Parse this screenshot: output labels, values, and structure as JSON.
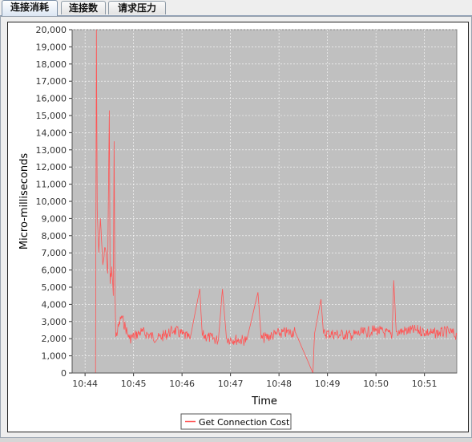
{
  "tabs": [
    {
      "label": "连接消耗",
      "active": true
    },
    {
      "label": "连接数",
      "active": false
    },
    {
      "label": "请求压力",
      "active": false
    }
  ],
  "colors": {
    "plot_background": "#c0c0c0",
    "series": "#ff5555",
    "gridline": "#ffffff"
  },
  "chart_data": {
    "type": "line",
    "title": "",
    "xlabel": "Time",
    "ylabel": "Micro-milliseconds",
    "ylim": [
      0,
      20000
    ],
    "y_ticks": [
      "0",
      "1,000",
      "2,000",
      "3,000",
      "4,000",
      "5,000",
      "6,000",
      "7,000",
      "8,000",
      "9,000",
      "10,000",
      "11,000",
      "12,000",
      "13,000",
      "14,000",
      "15,000",
      "16,000",
      "17,000",
      "18,000",
      "19,000",
      "20,000"
    ],
    "x_ticks": [
      "10:44",
      "10:45",
      "10:46",
      "10:47",
      "10:48",
      "10:49",
      "10:50",
      "10:51"
    ],
    "xlim": [
      "10:43:44",
      "10:51:40"
    ],
    "grid": true,
    "legend": {
      "position": "bottom-center"
    },
    "series": [
      {
        "name": "Get Connection Cost",
        "points": [
          [
            "10:44:13",
            0
          ],
          [
            "10:44:14",
            20000
          ],
          [
            "10:44:15",
            9500
          ],
          [
            "10:44:17",
            7000
          ],
          [
            "10:44:19",
            9000
          ],
          [
            "10:44:22",
            6300
          ],
          [
            "10:44:25",
            7300
          ],
          [
            "10:44:28",
            5800
          ],
          [
            "10:44:30",
            15300
          ],
          [
            "10:44:31",
            5200
          ],
          [
            "10:44:33",
            6200
          ],
          [
            "10:44:35",
            4500
          ],
          [
            "10:44:36",
            13500
          ],
          [
            "10:44:37",
            5000
          ],
          [
            "10:44:38",
            2100
          ],
          [
            "10:44:45",
            3300
          ],
          [
            "10:44:55",
            2000
          ],
          [
            "10:45:10",
            2400
          ],
          [
            "10:45:30",
            2000
          ],
          [
            "10:45:50",
            2500
          ],
          [
            "10:46:10",
            2000
          ],
          [
            "10:46:22",
            4900
          ],
          [
            "10:46:25",
            2200
          ],
          [
            "10:46:45",
            1900
          ],
          [
            "10:46:50",
            4900
          ],
          [
            "10:46:55",
            2000
          ],
          [
            "10:47:20",
            1900
          ],
          [
            "10:47:34",
            4700
          ],
          [
            "10:47:38",
            2000
          ],
          [
            "10:48:00",
            2300
          ],
          [
            "10:48:20",
            2400
          ],
          [
            "10:48:42",
            0
          ],
          [
            "10:48:44",
            2300
          ],
          [
            "10:48:52",
            4300
          ],
          [
            "10:48:55",
            2300
          ],
          [
            "10:49:30",
            2200
          ],
          [
            "10:50:00",
            2500
          ],
          [
            "10:50:20",
            2200
          ],
          [
            "10:50:22",
            5400
          ],
          [
            "10:50:25",
            2400
          ],
          [
            "10:50:50",
            2500
          ],
          [
            "10:51:10",
            2300
          ],
          [
            "10:51:30",
            2400
          ],
          [
            "10:51:40",
            2200
          ]
        ]
      }
    ]
  }
}
